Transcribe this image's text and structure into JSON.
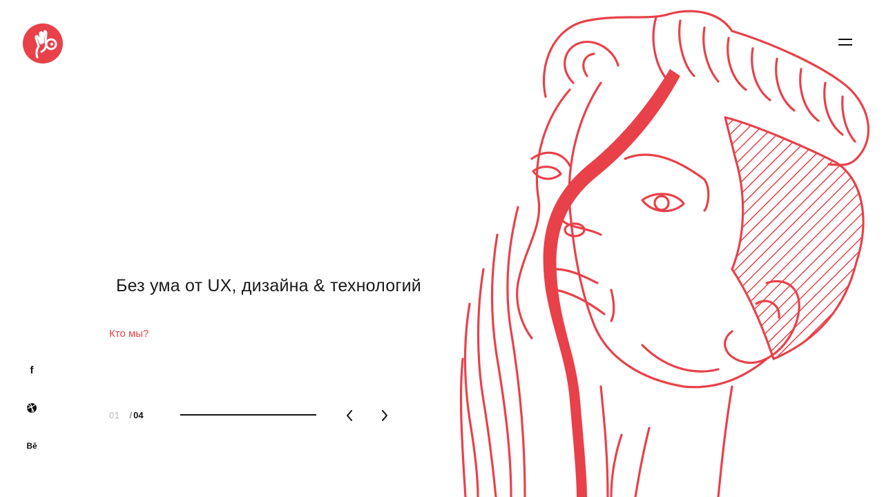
{
  "brand": {
    "logo_icon": "hand-ok-eye-icon",
    "accent_color": "#e8414a"
  },
  "header": {
    "menu_icon": "hamburger-menu-icon"
  },
  "hero": {
    "headline": "Без ума от UX, дизайна & технологий",
    "cta_link": "Кто мы?",
    "illustration": "line-art-face-icon"
  },
  "social": {
    "facebook_label": "f",
    "dribbble_icon": "dribbble-icon",
    "behance_label": "Bē"
  },
  "slider": {
    "current": "01",
    "separator": "/",
    "total": "04",
    "progress": 1.0,
    "prev_icon": "chevron-left-icon",
    "next_icon": "chevron-right-icon"
  }
}
